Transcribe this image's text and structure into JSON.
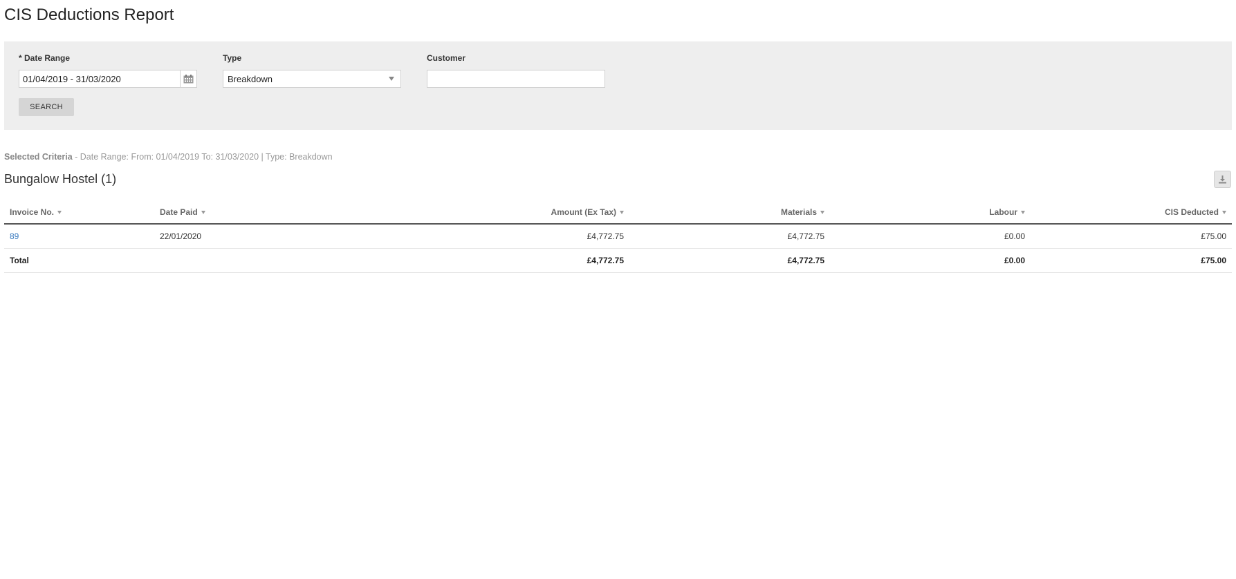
{
  "page": {
    "title": "CIS Deductions Report"
  },
  "filters": {
    "date_range": {
      "label": "* Date Range",
      "value": "01/04/2019 - 31/03/2020"
    },
    "type": {
      "label": "Type",
      "value": "Breakdown"
    },
    "customer": {
      "label": "Customer",
      "value": ""
    },
    "search_label": "SEARCH"
  },
  "criteria": {
    "heading": "Selected Criteria",
    "text": " - Date Range: From: 01/04/2019 To: 31/03/2020 | Type: Breakdown"
  },
  "group": {
    "title": "Bungalow Hostel (1)"
  },
  "table": {
    "columns": [
      "Invoice No.",
      "Date Paid",
      "Amount (Ex Tax)",
      "Materials",
      "Labour",
      "CIS Deducted"
    ],
    "rows": [
      {
        "invoice_no": "89",
        "date_paid": "22/01/2020",
        "amount": "£4,772.75",
        "materials": "£4,772.75",
        "labour": "£0.00",
        "cis_deducted": "£75.00"
      }
    ],
    "total": {
      "label": "Total",
      "amount": "£4,772.75",
      "materials": "£4,772.75",
      "labour": "£0.00",
      "cis_deducted": "£75.00"
    }
  },
  "icons": {
    "date_picker": "calendar-icon",
    "export": "download-icon",
    "select": "chevron-down-icon",
    "sort": "sort-down-icon"
  }
}
